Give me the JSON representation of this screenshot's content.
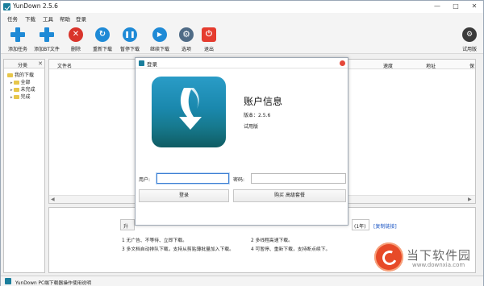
{
  "app": {
    "title": "YunDown 2.5.6"
  },
  "window_controls": {
    "minimize": "—",
    "maximize": "□",
    "close": "✕"
  },
  "menu": [
    "任务",
    "下载",
    "工具",
    "帮助",
    "登录"
  ],
  "toolbar": {
    "buttons": [
      {
        "label": "添加任务",
        "icon": "add-task-icon"
      },
      {
        "label": "添加BT文件",
        "icon": "add-bt-icon"
      },
      {
        "label": "删除",
        "icon": "delete-icon"
      },
      {
        "label": "重新下载",
        "icon": "redownload-icon"
      },
      {
        "label": "暂停下载",
        "icon": "pause-icon"
      },
      {
        "label": "继续下载",
        "icon": "resume-icon"
      },
      {
        "label": "选项",
        "icon": "gear-icon"
      },
      {
        "label": "退出",
        "icon": "power-icon"
      }
    ],
    "right_label": "试用版",
    "colors": {
      "blue": "#1f8ad6",
      "red": "#d9342b",
      "power_red": "#e53b2e",
      "gear_gray": "#4f6b86"
    }
  },
  "left_panel": {
    "header": "分类",
    "close": "✕",
    "tree": {
      "root": "我的下载",
      "children": [
        "全部",
        "未完成",
        "完成"
      ]
    }
  },
  "list": {
    "columns": [
      "文件名",
      "速度",
      "地址",
      "保"
    ],
    "scroll_left": "◀",
    "scroll_right": "▶"
  },
  "lower_panel": {
    "btn_partial": "升",
    "year_text": "(1年)",
    "link": "[复制链接]",
    "features": [
      "1 无广告、不等待、立即下载。",
      "2 多线程高速下载。",
      "3 多文档自动排队下载，支持从剪贴薄批量加入下载。",
      "4 可暂停、重新下载，支持断点续下。"
    ]
  },
  "status_bar": {
    "text": "YunDown PC端下载器操作使用说明"
  },
  "watermark": {
    "title": "当下软件园",
    "url": "www.downxia.com"
  },
  "modal": {
    "title": "登录",
    "info_title": "账户信息",
    "version_line": "版本：2.5.6",
    "edition_line": "试用版",
    "user_label": "用户:",
    "password_label": "密码:",
    "user_value": "",
    "password_value": "",
    "login_button": "登录",
    "buy_button": "购买 高级套餐",
    "logo_colors": {
      "top": "#2a9cc7",
      "bottom": "#0f5c63"
    }
  }
}
